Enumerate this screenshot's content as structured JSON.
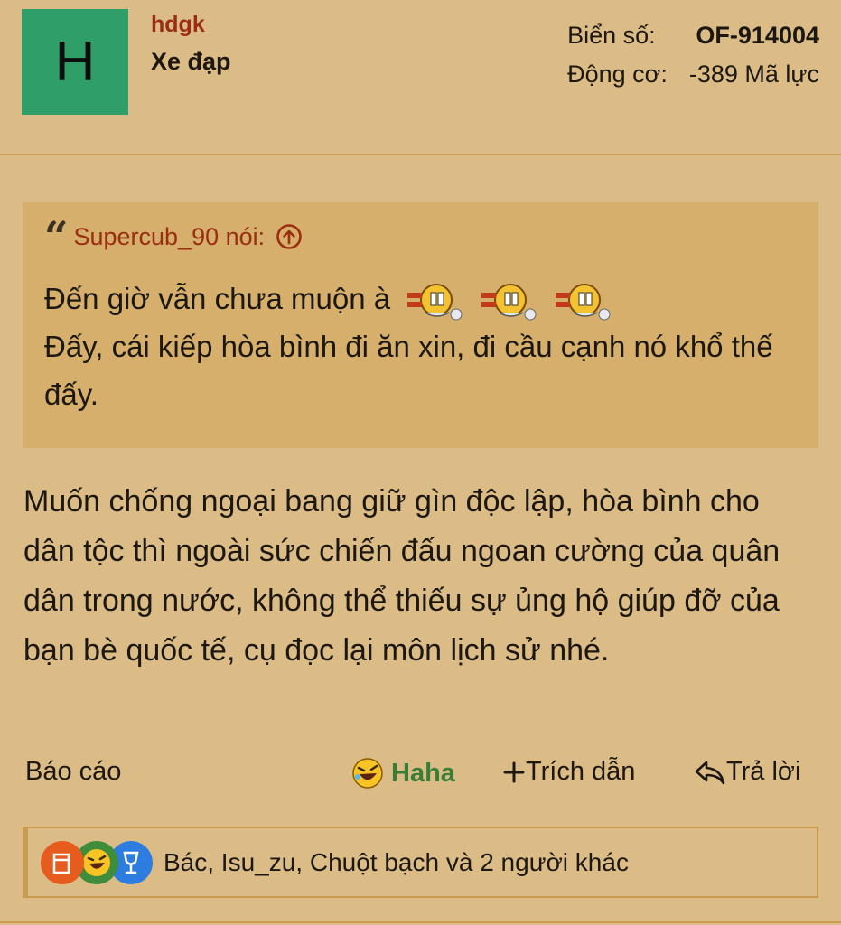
{
  "author": {
    "avatar_letter": "H",
    "avatar_color": "#2f9e68",
    "username": "hdgk",
    "title": "Xe đạp"
  },
  "user_info": {
    "plate_label": "Biển số:",
    "plate_value": "OF-914004",
    "engine_label": "Động cơ:",
    "engine_value": "-389 Mã lực"
  },
  "quote": {
    "author_line": "Supercub_90 nói:",
    "icon": "arrow-up-circle-icon",
    "line1": "Đến giờ vẫn chưa muộn à",
    "line2": "Đấy, cái kiếp hòa bình đi ăn xin, đi cầu cạnh nó khổ thế đấy.",
    "emoji_count": 3
  },
  "post": {
    "body": "Muốn chống ngoại bang giữ gìn độc lập, hòa bình cho dân tộc thì ngoài sức chiến đấu ngoan cường của quân dân trong nước, không thể thiếu sự ủng hộ giúp đỡ của bạn bè quốc tế, cụ đọc lại môn lịch sử nhé."
  },
  "actions": {
    "report": "Báo cáo",
    "haha": "Haha",
    "quote_btn": "Trích dẫn",
    "reply": "Trả lời"
  },
  "reactions": {
    "text": "Bác, Isu_zu, Chuột bạch và 2 người khác",
    "icons": [
      "beer-icon",
      "haha-icon",
      "wine-glass-icon"
    ]
  },
  "colors": {
    "background": "#dbbc87",
    "quote_bg": "#d5af6b",
    "accent_red": "#9b2d12",
    "haha_green": "#3a7d37",
    "border": "#c89a52"
  }
}
